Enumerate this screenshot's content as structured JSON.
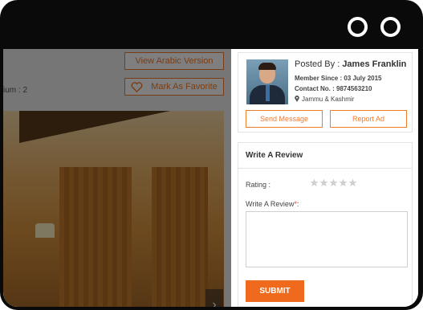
{
  "listing": {
    "arabic_button": "View Arabic Version",
    "favorite_button": "Mark As Favorite",
    "partial_label": "ium : 2",
    "next_arrow": "›"
  },
  "seller": {
    "posted_by_prefix": "Posted By : ",
    "name": "James Franklin",
    "member_since": "Member Since : 03 July 2015",
    "contact": "Contact No. : 9874563210",
    "location": "Jammu & Kashmir",
    "send_button": "Send Message",
    "report_button": "Report Ad"
  },
  "review": {
    "title": "Write A Review",
    "rating_label": "Rating :",
    "rating_value": 0,
    "rating_max": 5,
    "write_label": "Write A Review",
    "required_mark": "*",
    "write_label_suffix": ":",
    "textarea_value": "",
    "submit_button": "SUBMIT"
  },
  "colors": {
    "accent": "#f07a2c",
    "submit": "#f06a1e",
    "star_empty": "#cfcfcf"
  }
}
